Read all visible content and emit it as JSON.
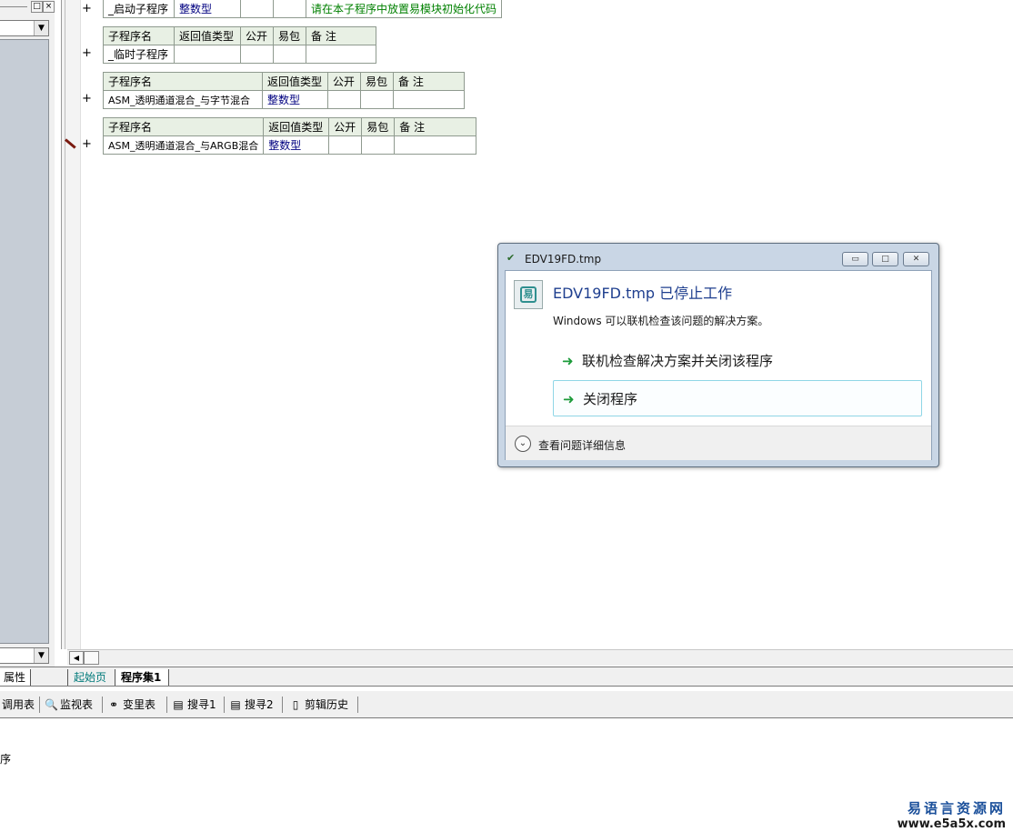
{
  "left_panel": {
    "restore_icon": "□",
    "close_icon": "×",
    "dropdown_icon": "▼"
  },
  "code": {
    "plus": "+",
    "header": {
      "name": "子程序名",
      "return_type": "返回值类型",
      "public": "公开",
      "easy_pkg": "易包",
      "remark": "备 注"
    },
    "rows": [
      {
        "name": "_启动子程序",
        "return_type": "整数型",
        "remark": "请在本子程序中放置易模块初始化代码"
      },
      {
        "name": "_临时子程序",
        "return_type": "",
        "remark": ""
      },
      {
        "name": "ASM_透明通道混合_与字节混合",
        "return_type": "整数型",
        "remark": ""
      },
      {
        "name": "ASM_透明通道混合_与ARGB混合",
        "return_type": "整数型",
        "remark": ""
      }
    ]
  },
  "scroll": {
    "left_icon": "◀"
  },
  "tabs": {
    "properties": "属性",
    "start_page": "起始页",
    "program_set": "程序集1"
  },
  "toolbar": {
    "items": [
      {
        "label": "调用表",
        "icon": "call-table-icon"
      },
      {
        "label": "监视表",
        "icon": "magnifier-icon"
      },
      {
        "label": "变里表",
        "icon": "variables-icon"
      },
      {
        "label": "搜寻1",
        "icon": "search1-icon"
      },
      {
        "label": "搜寻2",
        "icon": "search2-icon"
      },
      {
        "label": "剪辑历史",
        "icon": "clip-history-icon"
      }
    ]
  },
  "output": {
    "text": "序"
  },
  "watermark": {
    "cn": "易语言资源网",
    "url": "www.e5a5x.com"
  },
  "dialog": {
    "title": "EDV19FD.tmp",
    "heading": "EDV19FD.tmp 已停止工作",
    "description": "Windows 可以联机检查该问题的解决方案。",
    "command_online": "联机检查解决方案并关闭该程序",
    "command_close": "关闭程序",
    "details": "查看问题详细信息",
    "minimize_icon": "▭",
    "maximize_icon": "□",
    "close_icon": "✕",
    "arrow_icon": "➜",
    "chevron_icon": "⌄"
  }
}
